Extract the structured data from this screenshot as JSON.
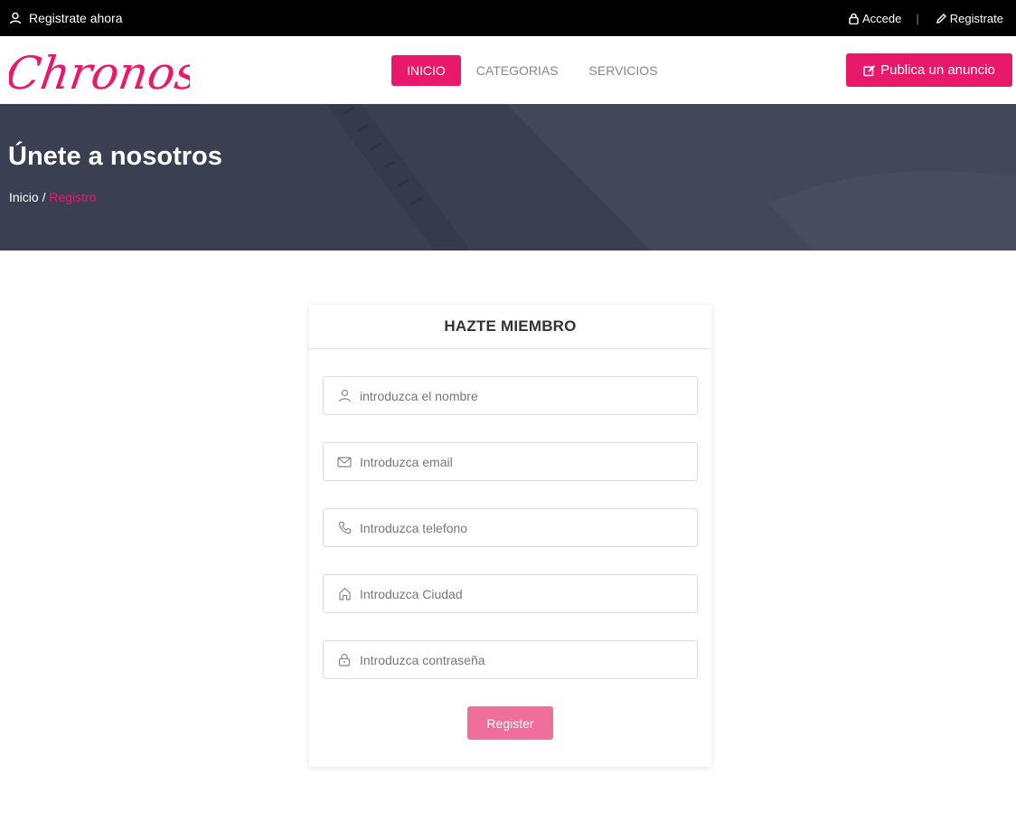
{
  "topbar": {
    "left_label": "Registrate ahora",
    "login_label": "Accede",
    "separator": "|",
    "register_label": "Registrate"
  },
  "brand": {
    "logo_text": "Chronos",
    "accent": "#e8196a"
  },
  "nav": {
    "items": [
      {
        "label": "INICIO",
        "active": true
      },
      {
        "label": "CATEGORIAS",
        "active": false
      },
      {
        "label": "SERVICIOS",
        "active": false
      }
    ],
    "publish_label": "Publica un anuncio"
  },
  "hero": {
    "title": "Únete a nosotros",
    "breadcrumb_home": "Inicio",
    "breadcrumb_sep": "/",
    "breadcrumb_current": "Registro"
  },
  "form": {
    "title": "HAZTE MIEMBRO",
    "fields": [
      {
        "icon": "user-icon",
        "placeholder": "introduzca el nombre"
      },
      {
        "icon": "envelope-icon",
        "placeholder": "Introduzca email"
      },
      {
        "icon": "phone-icon",
        "placeholder": "Introduzca telefono"
      },
      {
        "icon": "home-icon",
        "placeholder": "Introduzca Ciudad"
      },
      {
        "icon": "lock-icon",
        "placeholder": "Introduzca contraseña"
      }
    ],
    "submit_label": "Register"
  }
}
